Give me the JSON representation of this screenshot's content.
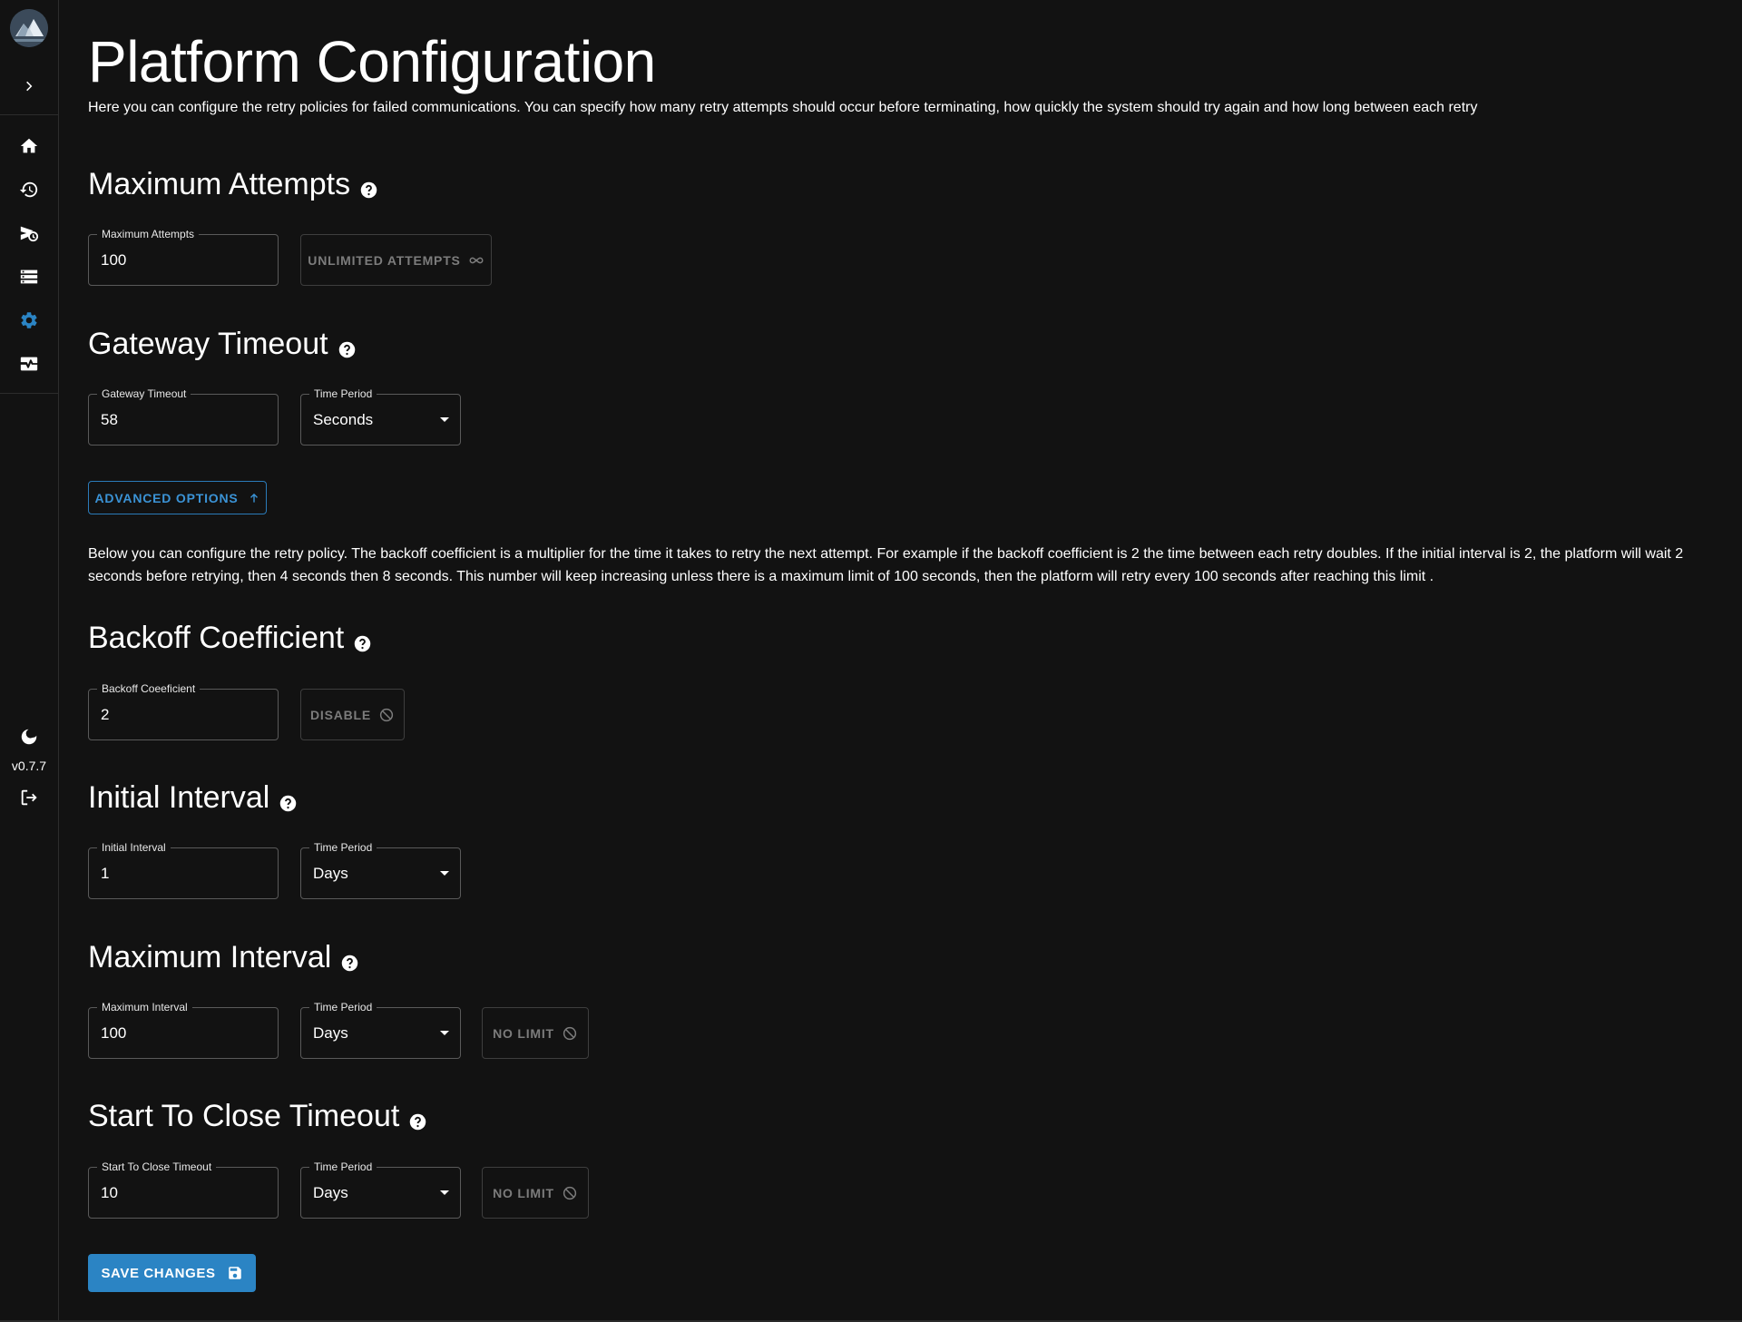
{
  "app": {
    "version": "v0.7.7"
  },
  "sidebar": {
    "items": [
      {
        "name": "home",
        "icon": "home-icon"
      },
      {
        "name": "history",
        "icon": "history-icon"
      },
      {
        "name": "scheduled",
        "icon": "scheduled-send-icon"
      },
      {
        "name": "storage",
        "icon": "storage-icon"
      },
      {
        "name": "settings",
        "icon": "gear-icon",
        "active": true
      },
      {
        "name": "monitoring",
        "icon": "monitor-heart-icon"
      }
    ],
    "accent": "#2b84c4"
  },
  "page": {
    "title": "Platform Configuration",
    "description": "Here you can configure the retry policies for failed communications. You can specify how many retry attempts should occur before terminating, how quickly the system should try again and how long between each retry"
  },
  "maximum_attempts": {
    "title": "Maximum Attempts",
    "label": "Maximum Attempts",
    "value": "100",
    "button": "UNLIMITED ATTEMPTS"
  },
  "gateway_timeout": {
    "title": "Gateway Timeout",
    "label": "Gateway Timeout",
    "value": "58",
    "period_label": "Time Period",
    "period_value": "Seconds"
  },
  "advanced": {
    "button": "ADVANCED OPTIONS",
    "description": "Below you can configure the retry policy. The backoff coefficient is a multiplier for the time it takes to retry the next attempt. For example if the backoff coefficient is 2 the time between each retry doubles. If the initial interval is 2, the platform will wait 2 seconds before retrying, then 4 seconds then 8 seconds. This number will keep increasing unless there is a maximum limit of 100 seconds, then the platform will retry every 100 seconds after reaching this limit ."
  },
  "backoff_coefficient": {
    "title": "Backoff Coefficient",
    "label": "Backoff Coeeficient",
    "value": "2",
    "button": "DISABLE"
  },
  "initial_interval": {
    "title": "Initial Interval",
    "label": "Initial Interval",
    "value": "1",
    "period_label": "Time Period",
    "period_value": "Days"
  },
  "maximum_interval": {
    "title": "Maximum Interval",
    "label": "Maximum Interval",
    "value": "100",
    "period_label": "Time Period",
    "period_value": "Days",
    "button": "NO LIMIT"
  },
  "start_to_close": {
    "title": "Start To Close Timeout",
    "label": "Start To Close Timeout",
    "value": "10",
    "period_label": "Time Period",
    "period_value": "Days",
    "button": "NO LIMIT"
  },
  "save": {
    "label": "SAVE CHANGES"
  }
}
